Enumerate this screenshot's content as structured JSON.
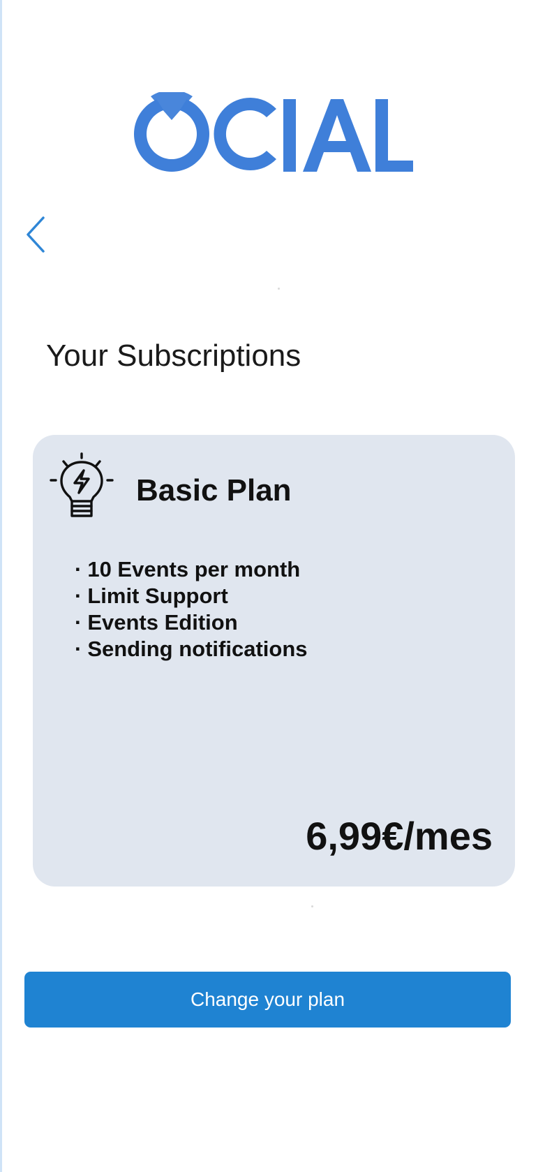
{
  "brand": {
    "logo_text": "OCIAL",
    "logo_color": "#3f7fd9"
  },
  "navigation": {
    "back_icon": "chevron-left-icon"
  },
  "page": {
    "title": "Your Subscriptions"
  },
  "subscription": {
    "icon": "lightbulb-bolt-icon",
    "plan_name": "Basic Plan",
    "features": [
      "10 Events per month",
      "Limit Support",
      "Events Edition",
      "Sending notifications"
    ],
    "price": "6,99€/mes"
  },
  "actions": {
    "change_plan_label": "Change your plan"
  },
  "colors": {
    "accent": "#1f83d2",
    "card_background": "#e0e6ef",
    "text": "#111111"
  }
}
